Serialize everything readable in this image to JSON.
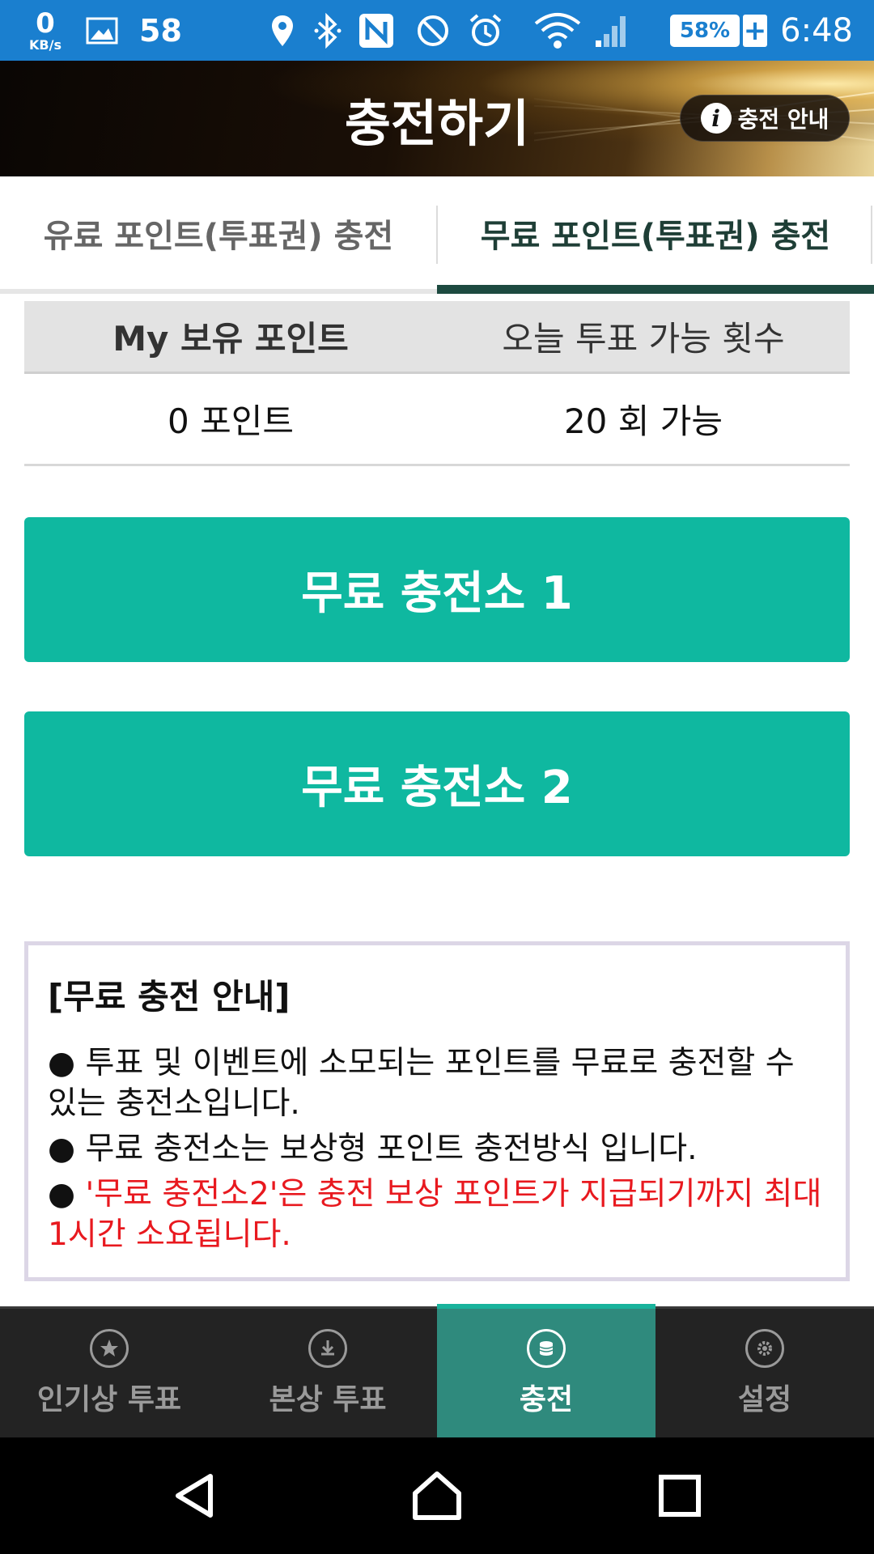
{
  "status_bar": {
    "net_speed_value": "0",
    "net_speed_unit": "KB/s",
    "notification_count": "58",
    "battery_percent": "58%",
    "time": "6:48",
    "icons": [
      "image-icon",
      "location-icon",
      "bluetooth-icon",
      "nfc-icon",
      "blocked-icon",
      "alarm-icon",
      "wifi-icon",
      "signal-icon",
      "battery-icon"
    ]
  },
  "header": {
    "title": "충전하기",
    "guide_button_label": "충전 안내",
    "guide_icon_glyph": "i"
  },
  "tabs": [
    {
      "label": "유료 포인트(투표권) 충전",
      "selected": false
    },
    {
      "label": "무료 포인트(투표권) 충전",
      "selected": true
    }
  ],
  "points_table": {
    "headers": [
      "My 보유 포인트",
      "오늘 투표 가능 횟수"
    ],
    "values": [
      "0 포인트",
      "20 회 가능"
    ]
  },
  "buttons": {
    "free_station_1": "무료 충전소 1",
    "free_station_2": "무료 충전소 2"
  },
  "info": {
    "title": "[무료 충전 안내]",
    "bullet": "●",
    "lines": [
      "투표 및 이벤트에 소모되는 포인트를 무료로 충전할 수 있는 충전소입니다.",
      "무료 충전소는 보상형 포인트 충전방식 입니다.",
      "'무료 충전소2'은 충전 보상 포인트가 지급되기까지 최대 1시간 소요됩니다."
    ],
    "highlight_color": "#e8191f"
  },
  "bottom_nav": [
    {
      "label": "인기상 투표",
      "icon": "star-icon",
      "active": false
    },
    {
      "label": "본상 투표",
      "icon": "download-icon",
      "active": false
    },
    {
      "label": "충전",
      "icon": "coin-stack-icon",
      "active": true
    },
    {
      "label": "설정",
      "icon": "gear-icon",
      "active": false
    }
  ],
  "colors": {
    "accent": "#0fb8a0",
    "nav_active": "#2f8a7d",
    "tab_indicator": "#1d4a40",
    "status_bar": "#1a7fcf"
  }
}
